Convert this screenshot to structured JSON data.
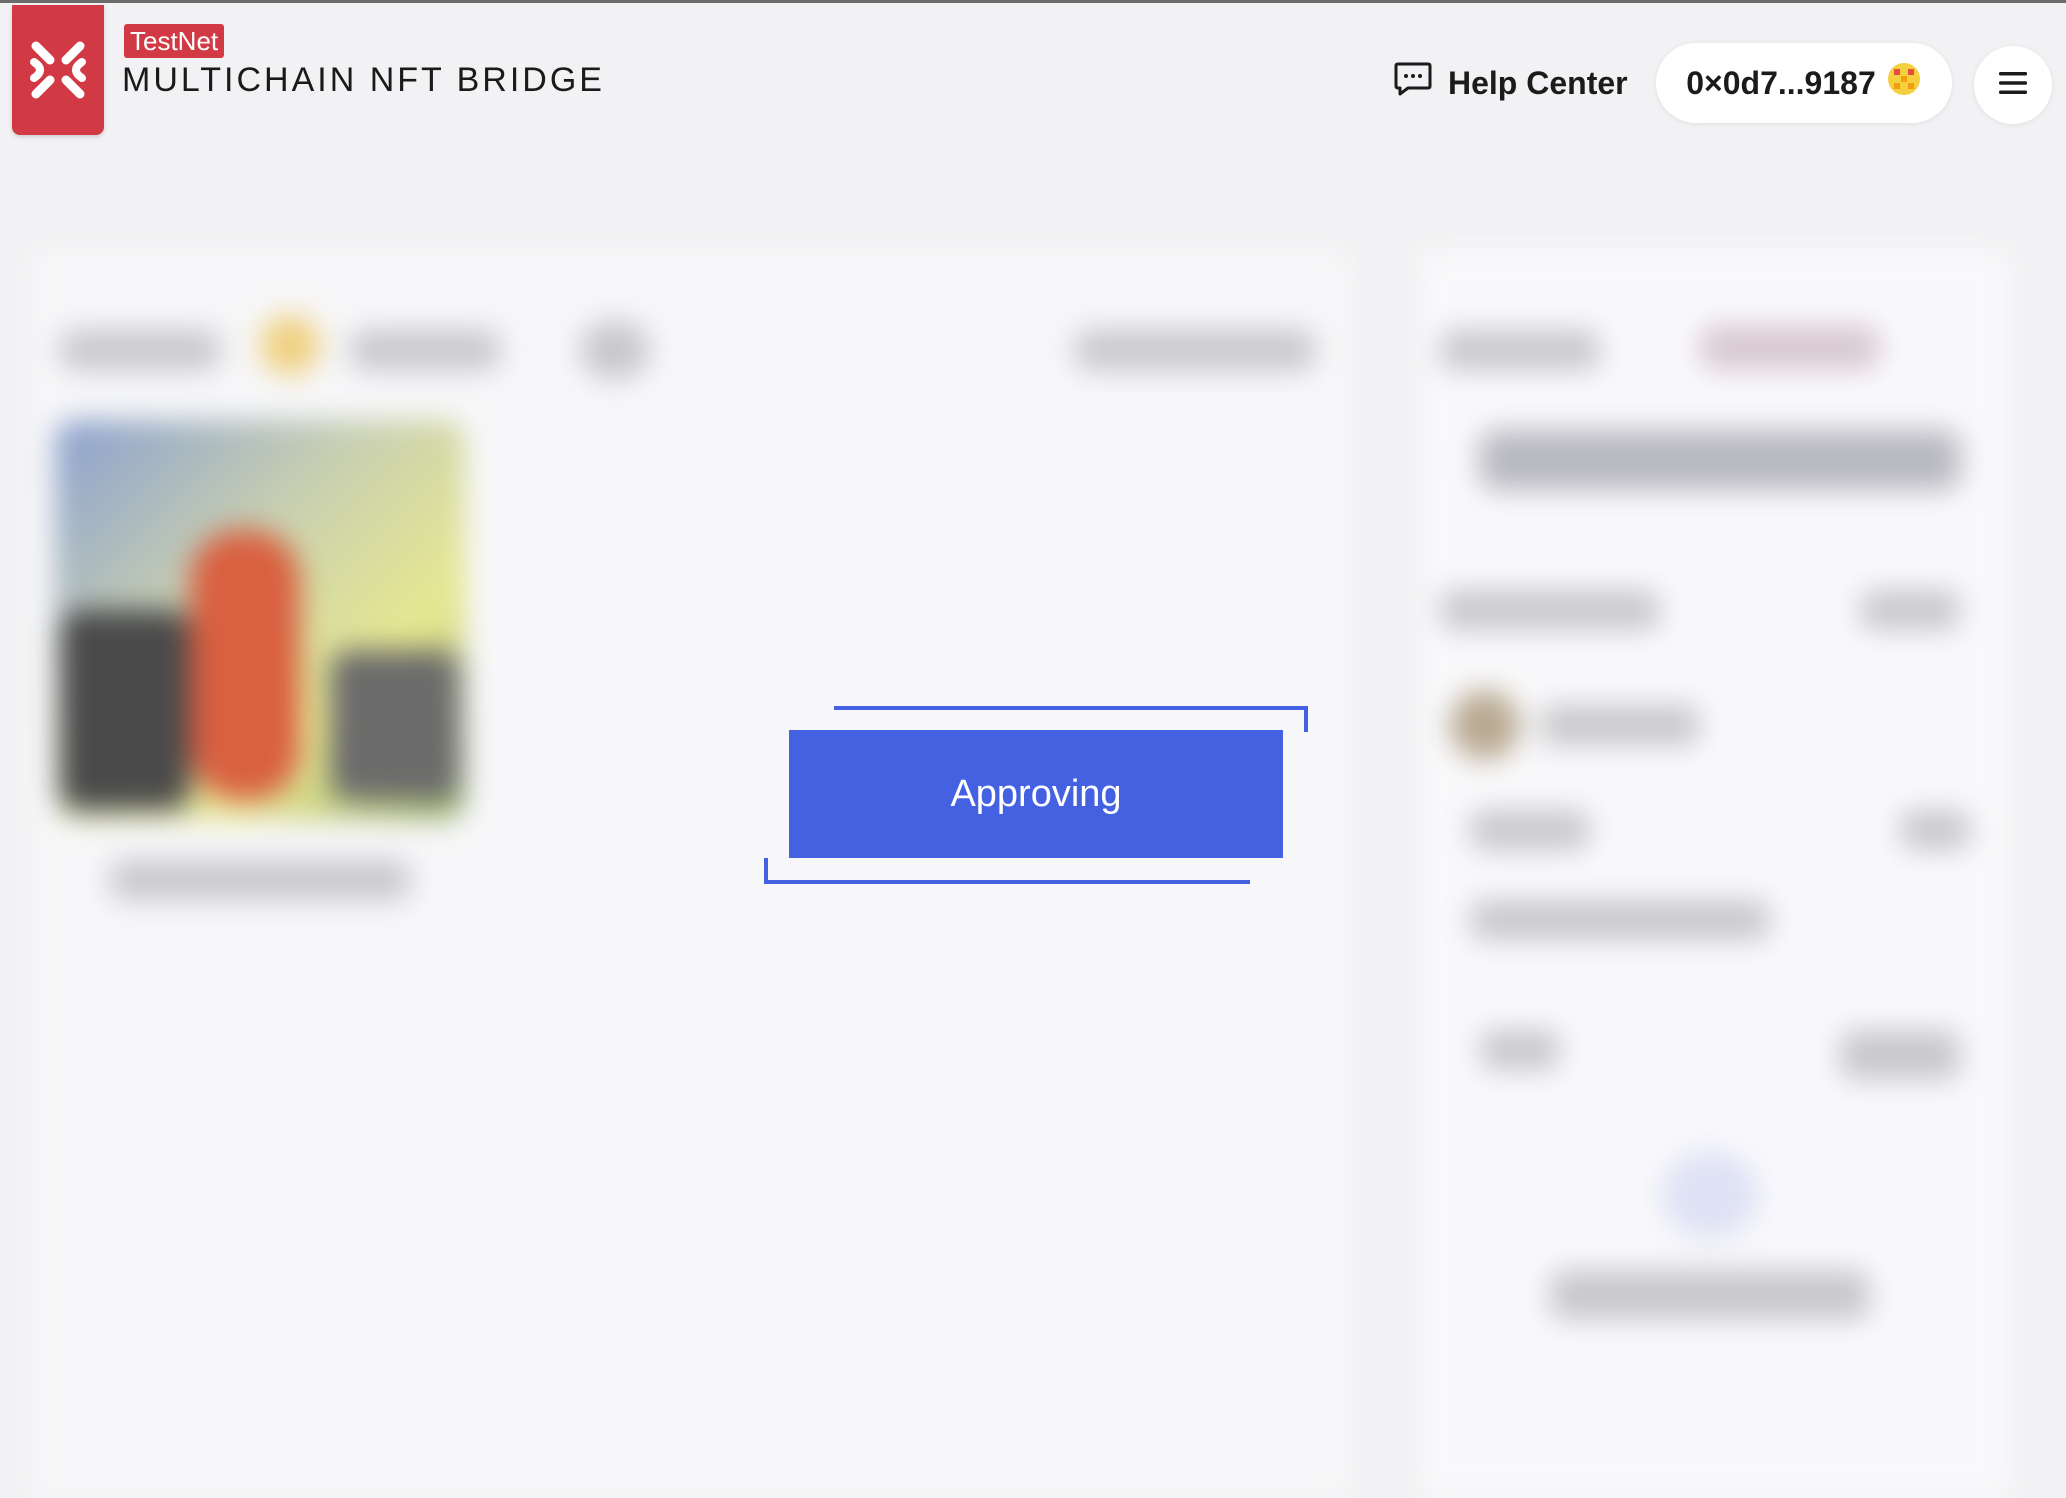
{
  "header": {
    "badge": "TestNet",
    "title": "MULTICHAIN NFT BRIDGE",
    "help_center_label": "Help Center",
    "wallet_address": "0×0d7...9187",
    "logo_icon": "xp-logo-icon",
    "menu_icon": "hamburger-menu-icon",
    "help_icon": "chat-bubble-icon"
  },
  "modal": {
    "status_label": "Approving"
  },
  "colors": {
    "brand_red": "#d13a44",
    "accent_blue": "#4361e0"
  }
}
